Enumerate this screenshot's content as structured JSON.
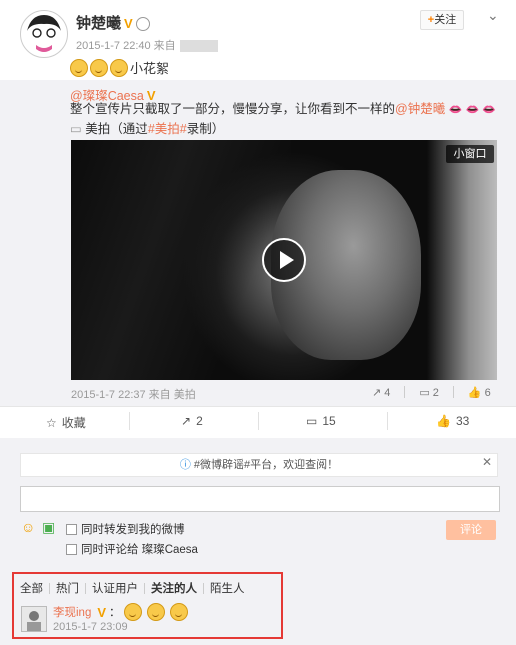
{
  "post": {
    "author": "钟楚曦",
    "verified_badge": "V",
    "timestamp": "2015-1-7 22:40 来自",
    "follow_label": "关注",
    "follow_plus": "+",
    "text": "小花絮"
  },
  "repost": {
    "author": "@璨璨Caesa",
    "verified_badge": "V",
    "text_part1": "整个宣传片只截取了一部分，慢慢分享，让你看到不一样的",
    "mention": "@钟楚曦",
    "text_part2": "美拍（通过",
    "hashtag": "#美拍#",
    "text_part3": "录制）",
    "video": {
      "mini_window_label": "小窗口"
    },
    "meta": "2015-1-7 22:37 来自 美拍",
    "reposts": "4",
    "comments": "2",
    "likes": "6"
  },
  "actions": {
    "favorite_label": "收藏",
    "repost_count": "2",
    "comment_count": "15",
    "like_count": "33"
  },
  "comment_box": {
    "notice": "#微博辟谣#平台，欢迎查阅！",
    "input_value": "",
    "repost_option": "同时转发到我的微博",
    "comment_option": "同时评论给 璨璨Caesa",
    "submit_label": "评论"
  },
  "comment_filters": [
    "全部",
    "热门",
    "认证用户",
    "关注的人",
    "陌生人"
  ],
  "active_filter": "关注的人",
  "comment": {
    "author": "李现ing",
    "verified_badge": "V",
    "separator": "：",
    "timestamp": "2015-1-7 23:09"
  },
  "colors": {
    "link": "#eb7350",
    "highlight_border": "#e53935",
    "verified": "#f2a000"
  }
}
